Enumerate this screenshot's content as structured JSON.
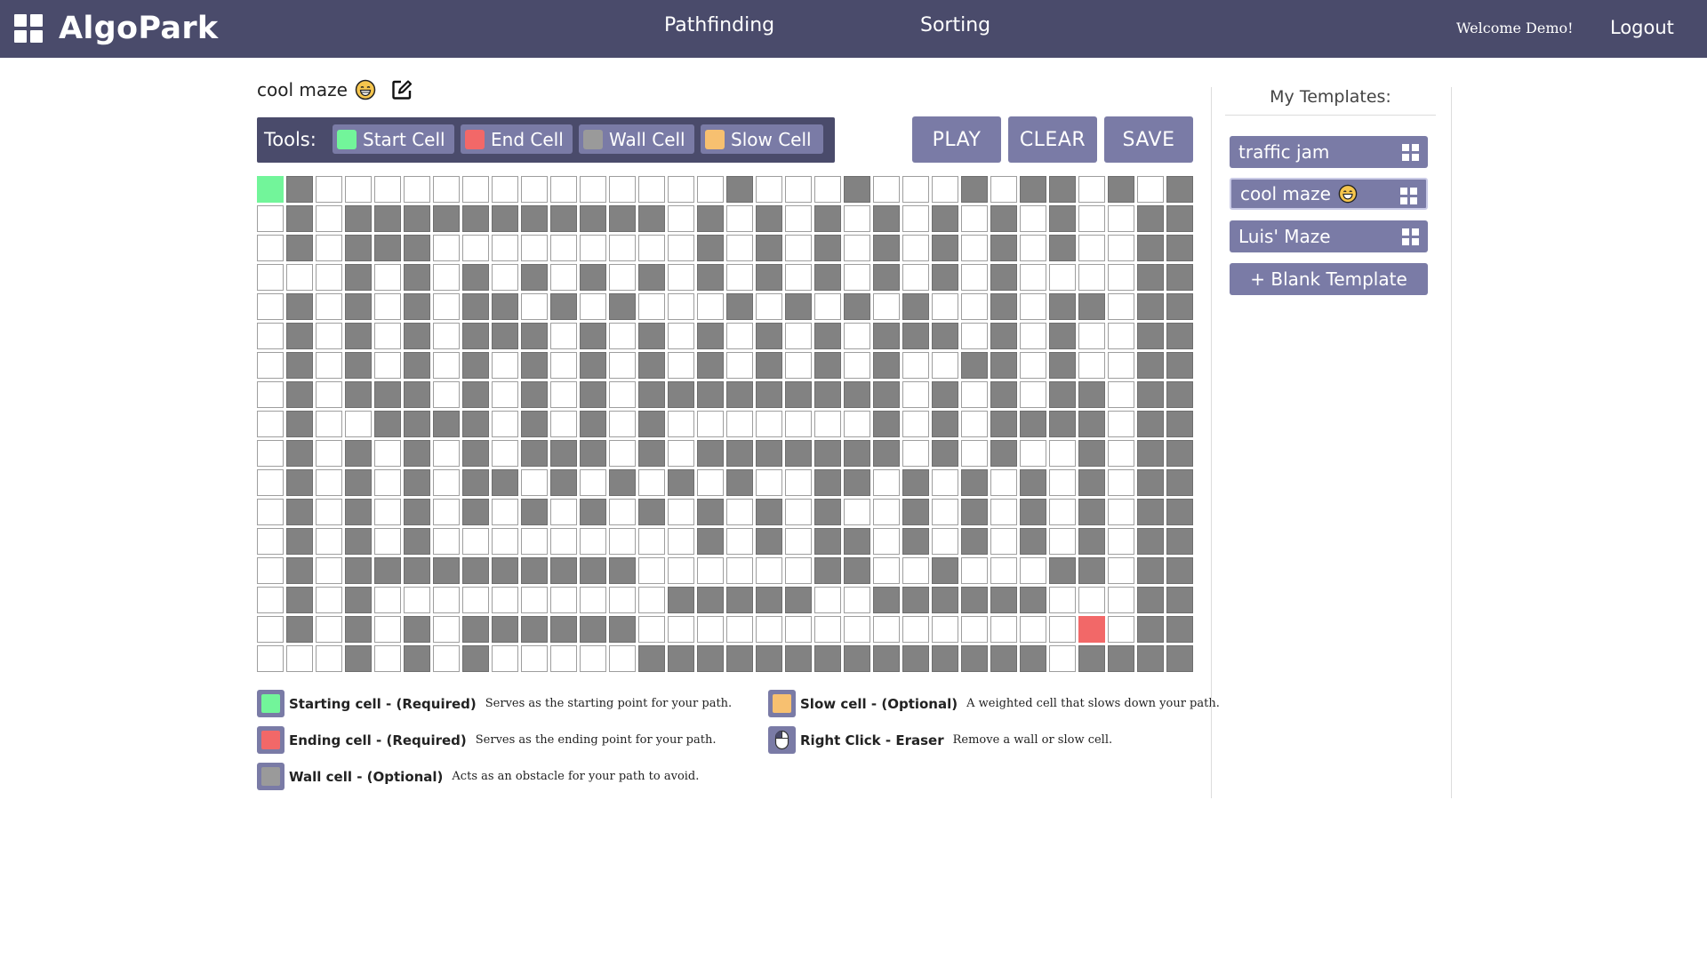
{
  "nav": {
    "brand": "AlgoPark",
    "links": [
      "Pathfinding",
      "Sorting"
    ],
    "welcome": "Welcome Demo!",
    "logout": "Logout",
    "bg_color": "#4a4b6b"
  },
  "editor": {
    "map_title": "cool maze",
    "title_emoji": "grinning-face-icon",
    "edit_icon": "edit-icon"
  },
  "tools": {
    "label": "Tools:",
    "items": [
      {
        "label": "Start Cell",
        "color": "#72f59a"
      },
      {
        "label": "End Cell",
        "color": "#f26868"
      },
      {
        "label": "Wall Cell",
        "color": "#9a9a9a"
      },
      {
        "label": "Slow Cell",
        "color": "#f7c070"
      }
    ]
  },
  "actions": {
    "play": "PLAY",
    "clear": "CLEAR",
    "save": "SAVE"
  },
  "grid": {
    "cols": 32,
    "rows": 17,
    "start": [
      0,
      0
    ],
    "end": [
      15,
      28
    ],
    "rows_pattern": [
      "0100000000000000100010001011010W",
      "0101111111111101010101010101001W",
      "0101110000000001010101010101001W",
      "0001010101010101010101010100001W",
      "0101010110101000101010100101101W",
      "0101010111010101010101110101001W",
      "0101010101010101010101001101001W",
      "0101110101010111111111010101101W",
      "0100111101010100000001010111101W",
      "0101010101110101111111010100101W",
      "0101010110101010100110101010101W",
      "0101010101010101010100101010101W",
      "0101010000000001010110101010101W",
      "0101111111111000000110010001101W",
      "0101000000000011111001111110001W",
      "0101010111111000000000000000001W",
      "0001010100000111111111111110111W"
    ]
  },
  "legend": [
    {
      "name": "Starting cell - (Required)",
      "desc": "Serves as the starting point for your path.",
      "color": "#72f59a"
    },
    {
      "name": "Ending cell - (Required)",
      "desc": "Serves as the ending point for your path.",
      "color": "#f26868"
    },
    {
      "name": "Wall cell - (Optional)",
      "desc": "Acts as an obstacle for your path to avoid.",
      "color": "#9a9a9a"
    },
    {
      "name": "Slow cell - (Optional)",
      "desc": "A weighted cell that slows down your path.",
      "color": "#f7c070"
    },
    {
      "name": "Right Click - Eraser",
      "desc": "Remove a wall or slow cell.",
      "icon": "mouse-right-click-icon"
    }
  ],
  "templates": {
    "title": "My Templates:",
    "items": [
      {
        "label": "traffic jam",
        "selected": false
      },
      {
        "label": "cool maze",
        "selected": true,
        "emoji": "grinning-face-icon"
      },
      {
        "label": "Luis' Maze",
        "selected": false
      }
    ],
    "blank": "+ Blank Template",
    "accent": "#7a7ba6"
  }
}
